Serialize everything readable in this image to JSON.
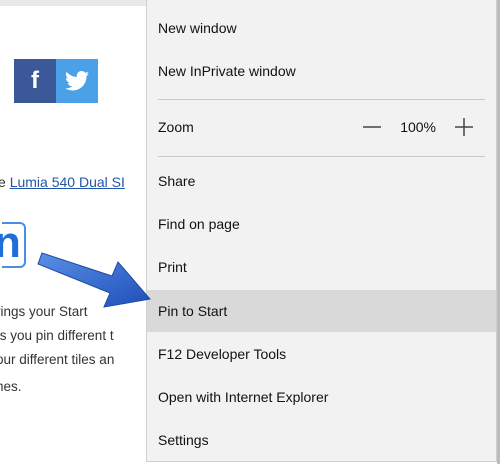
{
  "background_page": {
    "social": {
      "facebook_glyph": "f",
      "facebook_color": "#3b5998",
      "twitter_color": "#4aa1e8"
    },
    "lumia_prefix": "e ",
    "lumia_link": "Lumia 540 Dual SI",
    "heading_fragment": "n",
    "paragraph_lines": [
      "rings your Start",
      "ts you pin different t",
      "our different tiles an",
      "hes."
    ]
  },
  "menu": {
    "items": {
      "new_window": "New window",
      "new_inprivate": "New InPrivate window",
      "zoom_label": "Zoom",
      "zoom_minus": "—",
      "zoom_value": "100%",
      "zoom_plus": "+",
      "share": "Share",
      "find_on_page": "Find on page",
      "print": "Print",
      "pin_to_start": "Pin to Start",
      "dev_tools": "F12 Developer Tools",
      "open_ie": "Open with Internet Explorer",
      "settings": "Settings"
    },
    "highlighted_item": "Pin to Start",
    "highlight_color": "#d9d9d9",
    "background_color": "#f2f2f2"
  },
  "annotation": {
    "arrow_color": "#2f5fc4"
  }
}
